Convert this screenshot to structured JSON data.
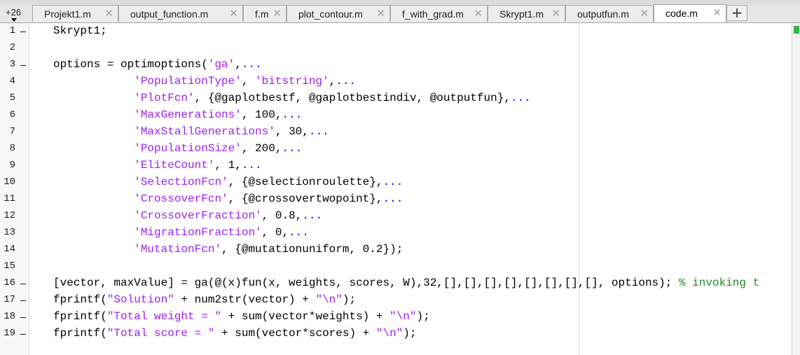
{
  "tabbar": {
    "overflow_count": "+26",
    "tabs": [
      {
        "label": "Projekt1.m",
        "active": false
      },
      {
        "label": "output_function.m",
        "active": false
      },
      {
        "label": "f.m",
        "active": false
      },
      {
        "label": "plot_contour.m",
        "active": false
      },
      {
        "label": "f_with_grad.m",
        "active": false
      },
      {
        "label": "Skrypt1.m",
        "active": false
      },
      {
        "label": "outputfun.m",
        "active": false
      },
      {
        "label": "code.m",
        "active": true
      }
    ],
    "close_glyph": "✕",
    "add_label": "+"
  },
  "editor": {
    "line_numbers": [
      "1",
      "2",
      "3",
      "4",
      "5",
      "6",
      "7",
      "8",
      "9",
      "10",
      "11",
      "12",
      "13",
      "14",
      "15",
      "16",
      "17",
      "18",
      "19"
    ],
    "executable_marker_lines": [
      1,
      3,
      16,
      17,
      18,
      19
    ],
    "lines": [
      [
        {
          "t": "Skrypt1;",
          "k": "n"
        }
      ],
      [],
      [
        {
          "t": "options = optimoptions(",
          "k": "n"
        },
        {
          "t": "'ga'",
          "k": "s"
        },
        {
          "t": ",",
          "k": "n"
        },
        {
          "t": "...",
          "k": "e"
        }
      ],
      [
        {
          "t": "            ",
          "k": "n"
        },
        {
          "t": "'PopulationType'",
          "k": "s"
        },
        {
          "t": ", ",
          "k": "n"
        },
        {
          "t": "'bitstring'",
          "k": "s"
        },
        {
          "t": ",",
          "k": "n"
        },
        {
          "t": "...",
          "k": "e"
        }
      ],
      [
        {
          "t": "            ",
          "k": "n"
        },
        {
          "t": "'PlotFcn'",
          "k": "s"
        },
        {
          "t": ", {@gaplotbestf, @gaplotbestindiv, @outputfun},",
          "k": "n"
        },
        {
          "t": "...",
          "k": "e"
        }
      ],
      [
        {
          "t": "            ",
          "k": "n"
        },
        {
          "t": "'MaxGenerations'",
          "k": "s"
        },
        {
          "t": ", 100,",
          "k": "n"
        },
        {
          "t": "...",
          "k": "e"
        }
      ],
      [
        {
          "t": "            ",
          "k": "n"
        },
        {
          "t": "'MaxStallGenerations'",
          "k": "s"
        },
        {
          "t": ", 30,",
          "k": "n"
        },
        {
          "t": "...",
          "k": "e"
        }
      ],
      [
        {
          "t": "            ",
          "k": "n"
        },
        {
          "t": "'PopulationSize'",
          "k": "s"
        },
        {
          "t": ", 200,",
          "k": "n"
        },
        {
          "t": "...",
          "k": "e"
        }
      ],
      [
        {
          "t": "            ",
          "k": "n"
        },
        {
          "t": "'EliteCount'",
          "k": "s"
        },
        {
          "t": ", 1,",
          "k": "n"
        },
        {
          "t": "...",
          "k": "e"
        }
      ],
      [
        {
          "t": "            ",
          "k": "n"
        },
        {
          "t": "'SelectionFcn'",
          "k": "s"
        },
        {
          "t": ", {@selectionroulette},",
          "k": "n"
        },
        {
          "t": "...",
          "k": "e"
        }
      ],
      [
        {
          "t": "            ",
          "k": "n"
        },
        {
          "t": "'CrossoverFcn'",
          "k": "s"
        },
        {
          "t": ", {@crossovertwopoint},",
          "k": "n"
        },
        {
          "t": "...",
          "k": "e"
        }
      ],
      [
        {
          "t": "            ",
          "k": "n"
        },
        {
          "t": "'CrossoverFraction'",
          "k": "s"
        },
        {
          "t": ", 0.8,",
          "k": "n"
        },
        {
          "t": "...",
          "k": "e"
        }
      ],
      [
        {
          "t": "            ",
          "k": "n"
        },
        {
          "t": "'MigrationFraction'",
          "k": "s"
        },
        {
          "t": ", 0,",
          "k": "n"
        },
        {
          "t": "...",
          "k": "e"
        }
      ],
      [
        {
          "t": "            ",
          "k": "n"
        },
        {
          "t": "'MutationFcn'",
          "k": "s"
        },
        {
          "t": ", {@mutationuniform, 0.2});",
          "k": "n"
        }
      ],
      [],
      [
        {
          "t": "[vector, maxValue] = ga(@(x)fun(x, weights, scores, W),32,[],[],[],[],[],[],[],[], options); ",
          "k": "n"
        },
        {
          "t": "% invoking t",
          "k": "c"
        }
      ],
      [
        {
          "t": "fprintf(",
          "k": "n"
        },
        {
          "t": "\"Solution\"",
          "k": "s"
        },
        {
          "t": " + num2str(vector) + ",
          "k": "n"
        },
        {
          "t": "\"\\n\"",
          "k": "s"
        },
        {
          "t": ");",
          "k": "n"
        }
      ],
      [
        {
          "t": "fprintf(",
          "k": "n"
        },
        {
          "t": "\"Total weight = \"",
          "k": "s"
        },
        {
          "t": " + sum(vector*weights) + ",
          "k": "n"
        },
        {
          "t": "\"\\n\"",
          "k": "s"
        },
        {
          "t": ");",
          "k": "n"
        }
      ],
      [
        {
          "t": "fprintf(",
          "k": "n"
        },
        {
          "t": "\"Total score = \"",
          "k": "s"
        },
        {
          "t": " + sum(vector*scores) + ",
          "k": "n"
        },
        {
          "t": "\"\\n\"",
          "k": "s"
        },
        {
          "t": ");",
          "k": "n"
        }
      ]
    ]
  },
  "colors": {
    "string": "#a020f0",
    "comment": "#228b22",
    "ellipsis": "#0000ff",
    "code": "#000000",
    "indicator": "#3cb44b"
  }
}
